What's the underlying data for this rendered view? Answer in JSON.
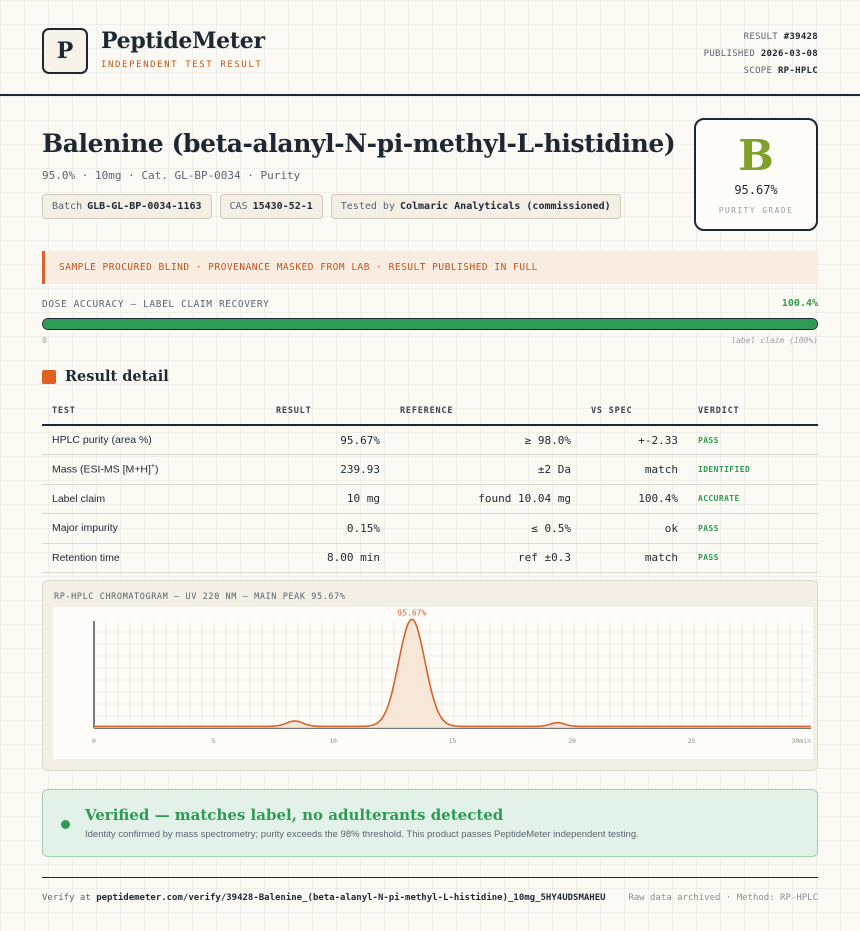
{
  "header": {
    "logo_letter": "P",
    "brand": "PeptideMeter",
    "brand_sub": "INDEPENDENT TEST RESULT",
    "result_label": "RESULT",
    "result_id": "#39428",
    "published_label": "PUBLISHED",
    "published_date": "2026-03-08",
    "scope_label": "SCOPE",
    "scope_value": "RP-HPLC"
  },
  "product": {
    "title": "Balenine (beta-alanyl-N-pi-methyl-L-histidine)",
    "subtitle": "95.0% · 10mg · Cat. GL-BP-0034 · Purity",
    "chips": [
      {
        "label": "Batch",
        "value": "GLB-GL-BP-0034-1163"
      },
      {
        "label": "CAS",
        "value": "15430-52-1"
      },
      {
        "label": "Tested by",
        "value": "Colmaric Analyticals (commissioned)"
      }
    ]
  },
  "grade": {
    "letter": "B",
    "value": "95.67%",
    "label": "PURITY GRADE",
    "color": "#7fa02a"
  },
  "notice": "SAMPLE PROCURED BLIND · PROVENANCE MASKED FROM LAB · RESULT PUBLISHED IN FULL",
  "dose": {
    "label": "DOSE ACCURACY — LABEL CLAIM RECOVERY",
    "value": "100.4%",
    "fill_percent": 100,
    "min_label": "0",
    "max_label": "label claim (100%)"
  },
  "section": {
    "title": "Result detail"
  },
  "table": {
    "headers": [
      "TEST",
      "RESULT",
      "REFERENCE",
      "VS SPEC",
      "VERDICT"
    ],
    "rows": [
      {
        "test": "HPLC purity (area %)",
        "result": "95.67%",
        "reference": "≥ 98.0%",
        "vs_spec": "+-2.33",
        "verdict": "PASS"
      },
      {
        "test": "Mass (ESI-MS [M+H]",
        "test_sup": "+",
        "test_end": ")",
        "result": "239.93",
        "reference": "±2 Da",
        "vs_spec": "match",
        "verdict": "IDENTIFIED"
      },
      {
        "test": "Label claim",
        "result": "10 mg",
        "reference": "found 10.04 mg",
        "vs_spec": "100.4%",
        "verdict": "ACCURATE"
      },
      {
        "test": "Major impurity",
        "result": "0.15%",
        "reference": "≤ 0.5%",
        "vs_spec": "ok",
        "verdict": "PASS"
      },
      {
        "test": "Retention time",
        "result": "8.00 min",
        "reference": "ref ±0.3",
        "vs_spec": "match",
        "verdict": "PASS"
      }
    ]
  },
  "chart_data": {
    "type": "line",
    "title": "RP-HPLC CHROMATOGRAM — UV 220 NM — MAIN PEAK 95.67%",
    "xlabel": "min",
    "ylabel": "",
    "xlim": [
      0,
      30
    ],
    "ylim": [
      0,
      100
    ],
    "x_ticks": [
      0,
      5,
      10,
      15,
      20,
      25,
      30
    ],
    "peaks": [
      {
        "x": 8.4,
        "height": 5,
        "width": 0.35
      },
      {
        "x": 13.3,
        "height": 100,
        "width": 0.55
      },
      {
        "x": 19.4,
        "height": 3.5,
        "width": 0.3
      }
    ],
    "baseline": 1.5,
    "annotation": "95.67%",
    "line_color": "#d9622a",
    "fill_color": "#f6e3d4",
    "grid": true
  },
  "verified": {
    "title": "Verified — matches label, no adulterants detected",
    "text": "Identity confirmed by mass spectrometry; purity exceeds the 98% threshold. This product passes PeptideMeter independent testing.",
    "color": "#2e9a54"
  },
  "footer": {
    "verify_prefix": "Verify at",
    "verify_url": "peptidemeter.com/verify/39428-Balenine_(beta-alanyl-N-pi-methyl-L-histidine)_10mg_5HY4UDSMAHEU",
    "right_text": "Raw data archived · Method: RP-HPLC"
  }
}
